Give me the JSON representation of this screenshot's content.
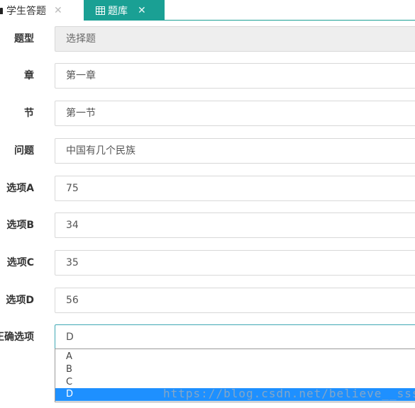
{
  "tabs": [
    {
      "label": "学生答题",
      "active": false
    },
    {
      "label": "题库",
      "active": true
    }
  ],
  "colors": {
    "tab_active": "#1aa094",
    "option_selected": "#1e90ff",
    "disabled_field": "#eeeeee"
  },
  "form": {
    "type": {
      "label": "题型",
      "value": "选择题"
    },
    "chapter": {
      "label": "章",
      "value": "第一章"
    },
    "section": {
      "label": "节",
      "value": "第一节"
    },
    "question": {
      "label": "问题",
      "value": "中国有几个民族"
    },
    "option_a": {
      "label": "选项A",
      "value": "75"
    },
    "option_b": {
      "label": "选项B",
      "value": "34"
    },
    "option_c": {
      "label": "选项C",
      "value": "35"
    },
    "option_d": {
      "label": "选项D",
      "value": "56"
    },
    "answer": {
      "label": "正确选项",
      "value": "D",
      "options": [
        "A",
        "B",
        "C",
        "D"
      ],
      "selected": "D"
    }
  },
  "watermark": "https://blog.csdn.net/believe__sss"
}
